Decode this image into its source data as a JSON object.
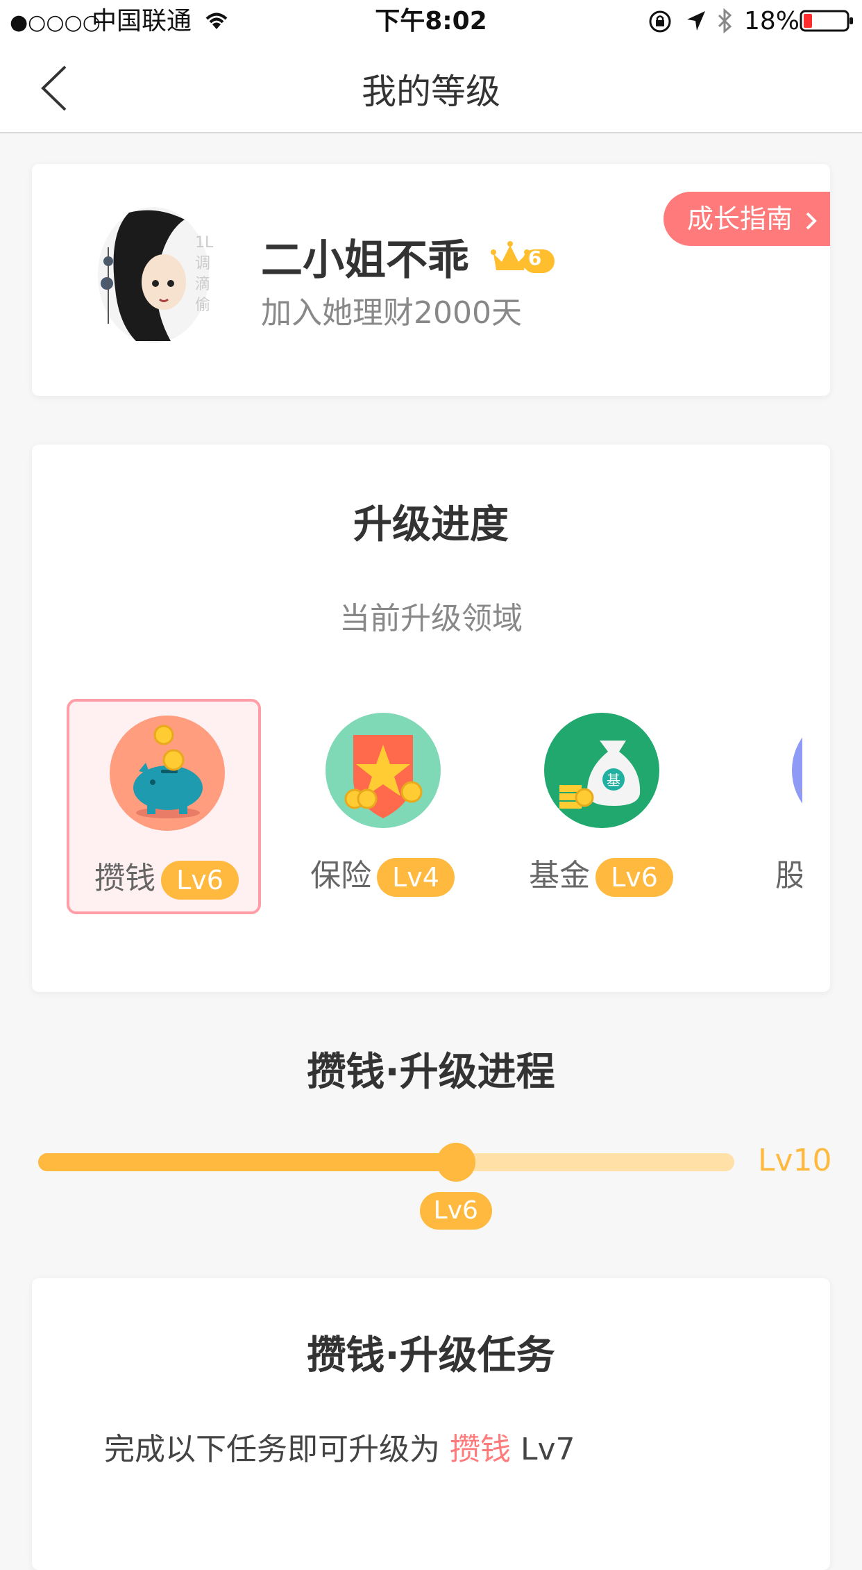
{
  "status_bar": {
    "signal": "●○○○○",
    "carrier": "中国联通",
    "time": "下午8:02",
    "battery": "18%"
  },
  "nav": {
    "title": "我的等级"
  },
  "profile": {
    "name": "二小姐不乖",
    "badge_level": "6",
    "days": "加入她理财2000天",
    "guide_button": "成长指南"
  },
  "upgrade": {
    "title": "升级进度",
    "subtitle": "当前升级领域",
    "domains": [
      {
        "name": "攒钱",
        "level": "Lv6",
        "active": true
      },
      {
        "name": "保险",
        "level": "Lv4",
        "active": false
      },
      {
        "name": "基金",
        "level": "Lv6",
        "active": false
      },
      {
        "name": "股票",
        "level": "",
        "active": false
      }
    ]
  },
  "progress": {
    "title": "攒钱·升级进程",
    "current_level": "Lv6",
    "max_level": "Lv10",
    "fraction": 0.6
  },
  "tasks": {
    "title": "攒钱·升级任务",
    "line_prefix": "完成以下任务即可升级为",
    "line_domain": "攒钱",
    "line_level": "Lv7"
  },
  "colors": {
    "accent": "#ffb93f",
    "accent_light": "#ffe0a6",
    "pink": "#ff7b7b",
    "active_border": "#ff9ea6"
  }
}
